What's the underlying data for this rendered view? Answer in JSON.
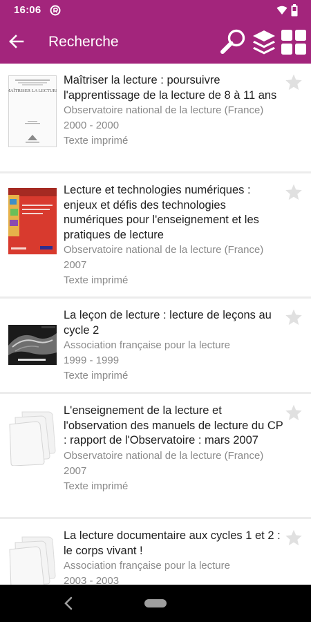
{
  "status_bar": {
    "time": "16:06"
  },
  "app_bar": {
    "title": "Recherche"
  },
  "results": [
    {
      "title": "Maîtriser la lecture : poursuivre l'apprentissage de la lecture de 8 à 11 ans",
      "author": "Observatoire national de la lecture (France)",
      "date": "2000 - 2000",
      "type": "Texte imprimé",
      "thumbnail": "book-cover-maitriser",
      "cover_text": "MAÎTRISER LA LECTURE"
    },
    {
      "title": "Lecture et technologies numériques : enjeux et défis des technologies numériques pour l'enseignement et les pratiques de lecture",
      "author": "Observatoire national de la lecture (France)",
      "date": "2007",
      "type": "Texte imprimé",
      "thumbnail": "book-cover-red"
    },
    {
      "title": "La leçon de lecture : lecture de leçons au cycle 2",
      "author": "Association française pour la lecture",
      "date": "1999 - 1999",
      "type": "Texte imprimé",
      "thumbnail": "book-cover-dark"
    },
    {
      "title": "L'enseignement de la lecture et l'observation des manuels de lecture du CP : rapport de l'Observatoire : mars 2007",
      "author": "Observatoire national de la lecture (France)",
      "date": "2007",
      "type": "Texte imprimé",
      "thumbnail": "document-placeholder-icon"
    },
    {
      "title": "La lecture documentaire aux cycles 1 et 2 : le corps vivant !",
      "author": "Association française pour la lecture",
      "date": "2003 - 2003",
      "type": "",
      "thumbnail": "document-placeholder-icon"
    }
  ],
  "icons": {
    "back": "arrow-left-icon",
    "search": "search-icon",
    "layers": "layers-icon",
    "grid": "grid-view-icon",
    "favorite": "star-icon"
  },
  "colors": {
    "primary": "#a3257c",
    "title_text": "#212121",
    "meta_text": "#8a8a8a",
    "star": "#e0e0e0"
  }
}
